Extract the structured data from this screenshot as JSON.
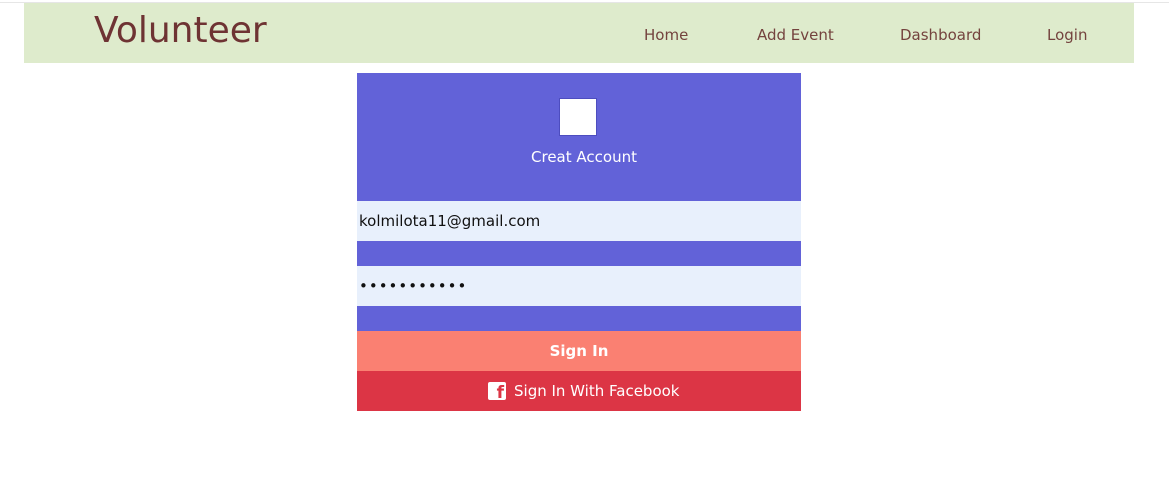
{
  "brand": "Volunteer",
  "nav": {
    "home": "Home",
    "add_event": "Add Event",
    "dashboard": "Dashboard",
    "login": "Login"
  },
  "login_card": {
    "title": "Creat Account",
    "email_value": "kolmilota11@gmail.com",
    "password_value": "•••••••••••",
    "signin_label": "Sign In",
    "facebook_label": "Sign In With Facebook",
    "facebook_icon": "facebook-icon"
  },
  "colors": {
    "navbar_bg": "#deebcc",
    "brand": "#6e3333",
    "card_bg": "#6262d8",
    "signin_bg": "#fa8072",
    "facebook_bg": "#dc3545"
  }
}
